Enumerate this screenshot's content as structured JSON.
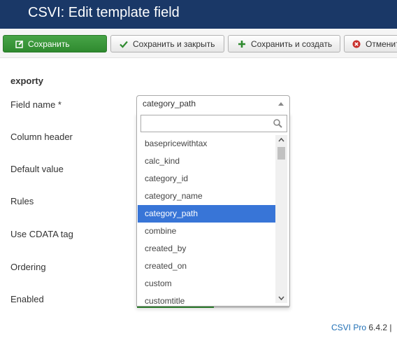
{
  "header": {
    "title": "CSVI: Edit template field"
  },
  "toolbar": {
    "save_label": "Сохранить",
    "save_close_label": "Сохранить и закрыть",
    "save_new_label": "Сохранить и создать",
    "cancel_label": "Отменит"
  },
  "form": {
    "section_title": "exporty",
    "labels": {
      "field_name": "Field name *",
      "column_header": "Column header",
      "default_value": "Default value",
      "rules": "Rules",
      "use_cdata": "Use CDATA tag",
      "ordering": "Ordering",
      "enabled": "Enabled"
    },
    "field_name_select": {
      "selected": "category_path",
      "search_value": "",
      "options": [
        "basepricewithtax",
        "calc_kind",
        "category_id",
        "category_name",
        "category_path",
        "combine",
        "created_by",
        "created_on",
        "custom",
        "customtitle"
      ],
      "highlighted_option": "category_path"
    }
  },
  "footer": {
    "product_link": "CSVI Pro",
    "version": "6.4.2 |"
  },
  "colors": {
    "header_bg": "#1a3867",
    "save_green": "#47a447",
    "selected_option": "#3875d7",
    "link": "#1f6fb5"
  },
  "icons": {
    "save": "edit-icon",
    "save_close": "check-icon",
    "save_new": "plus-icon",
    "cancel": "cancel-circle-icon",
    "search": "search-icon"
  }
}
